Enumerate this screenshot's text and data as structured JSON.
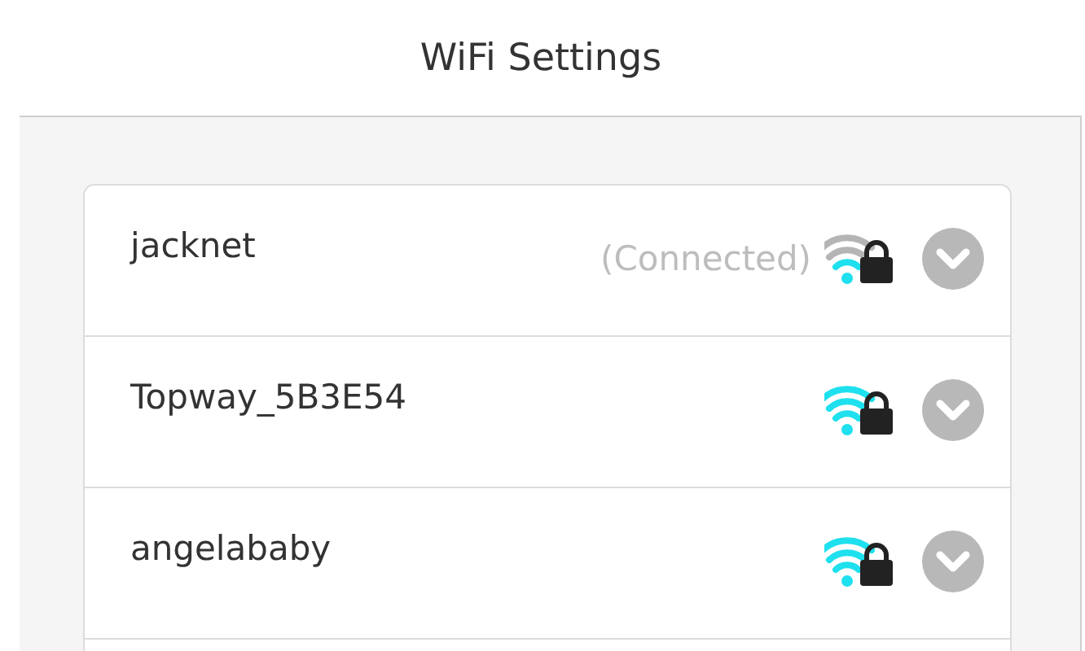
{
  "header": {
    "title": "WiFi Settings"
  },
  "networks": [
    {
      "name": "jacknet",
      "status": "(Connected)",
      "full_signal": false,
      "locked": true,
      "expanded": false
    },
    {
      "name": "Topway_5B3E54",
      "full_signal": true,
      "locked": true,
      "expanded": false
    },
    {
      "name": "angelababy",
      "full_signal": true,
      "locked": true,
      "expanded": false
    }
  ]
}
